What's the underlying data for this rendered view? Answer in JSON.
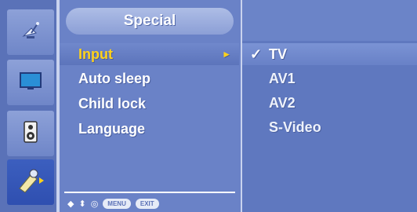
{
  "menu": {
    "title": "Special",
    "items": [
      {
        "label": "Input",
        "selected": true,
        "arrow": "►"
      },
      {
        "label": "Auto sleep",
        "selected": false
      },
      {
        "label": "Child lock",
        "selected": false
      },
      {
        "label": "Language",
        "selected": false
      }
    ]
  },
  "options": {
    "items": [
      {
        "label": "TV",
        "checked": true,
        "check_glyph": "✓"
      },
      {
        "label": "AV1",
        "checked": false
      },
      {
        "label": "AV2",
        "checked": false
      },
      {
        "label": "S-Video",
        "checked": false
      }
    ]
  },
  "nav": {
    "move_glyph": "◆",
    "updown_glyph": "⬍",
    "ok_glyph": "◎",
    "menu_label": "MENU",
    "exit_label": "EXIT"
  },
  "sidebar": {
    "icons": [
      "satellite-dish-icon",
      "screen-icon",
      "sound-icon",
      "special-tools-icon"
    ],
    "selected_index": 3
  },
  "colors": {
    "highlight_text": "#ffd21a",
    "panel_bg": "#6a82c7",
    "osd_bg": "#5f78bf"
  }
}
